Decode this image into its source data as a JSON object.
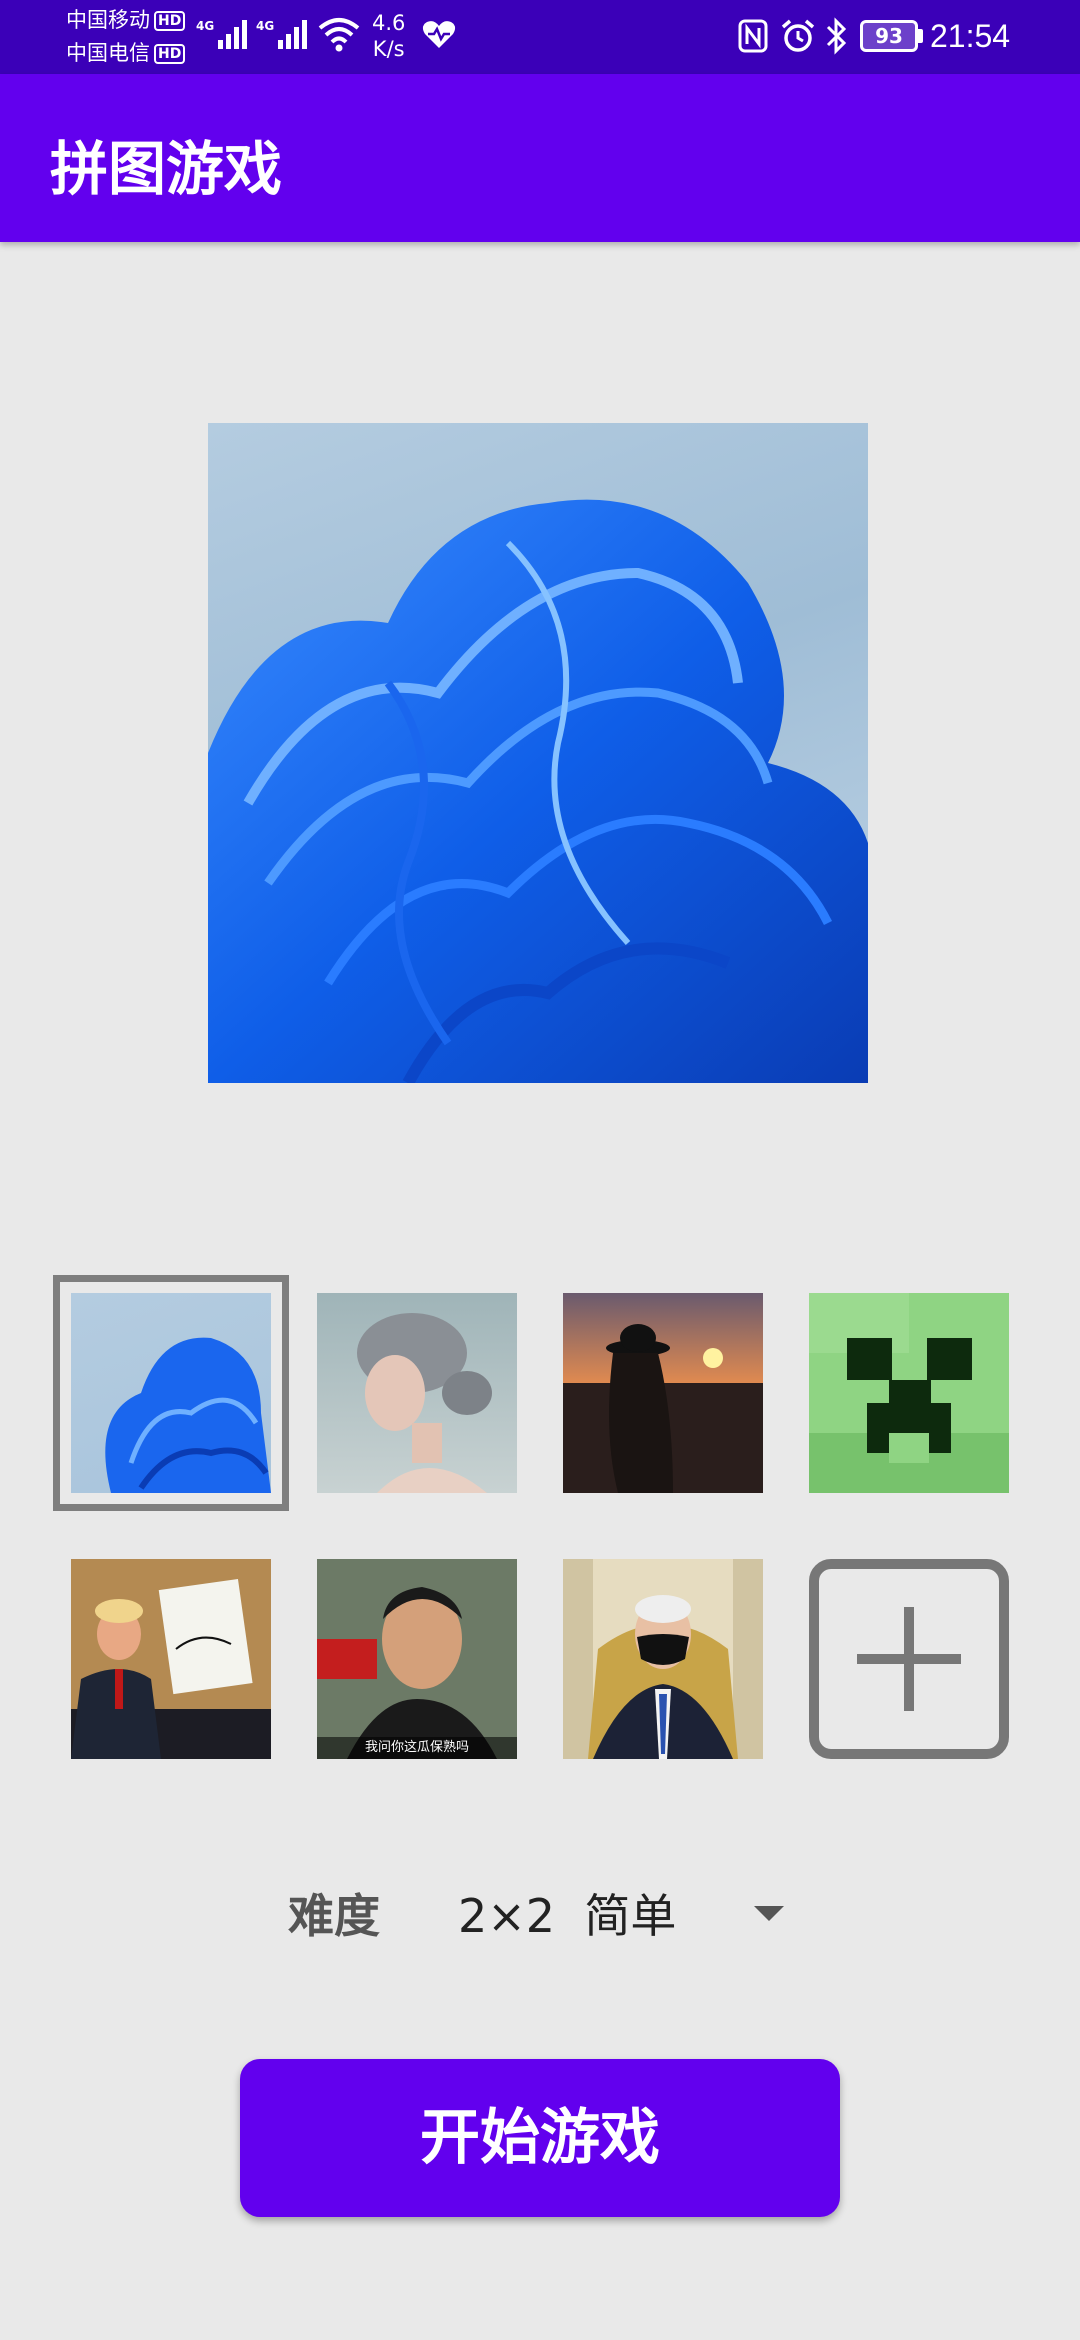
{
  "status_bar": {
    "carrier1": "中国移动",
    "carrier2": "中国电信",
    "hd_badge": "HD",
    "network_type": "4G",
    "speed_value": "4.6",
    "speed_unit": "K/s",
    "battery": "93",
    "time": "21:54",
    "icons": [
      "signal-icon",
      "wifi-icon",
      "heart-health-icon",
      "nfc-icon",
      "alarm-icon",
      "bluetooth-icon",
      "battery-icon"
    ]
  },
  "app_bar": {
    "title": "拼图游戏"
  },
  "preview": {
    "image": "blue-ribbon-wallpaper"
  },
  "gallery": {
    "selected_index": 0,
    "items": [
      {
        "image": "blue-ribbon-wallpaper"
      },
      {
        "image": "gray-haired-woman-portrait"
      },
      {
        "image": "woman-hat-sunset"
      },
      {
        "image": "green-creeper-face"
      },
      {
        "image": "man-holding-signed-document"
      },
      {
        "image": "man-video-frame",
        "caption": "我问你这瓜保熟吗"
      },
      {
        "image": "man-wearing-mask-seated"
      }
    ],
    "add_icon": "plus-icon"
  },
  "difficulty": {
    "label": "难度",
    "value": "2×2  简单"
  },
  "start_button": {
    "label": "开始游戏"
  },
  "colors": {
    "primary": "#6200ee",
    "status_bar": "#3b00b8",
    "background": "#e9e9e9"
  }
}
